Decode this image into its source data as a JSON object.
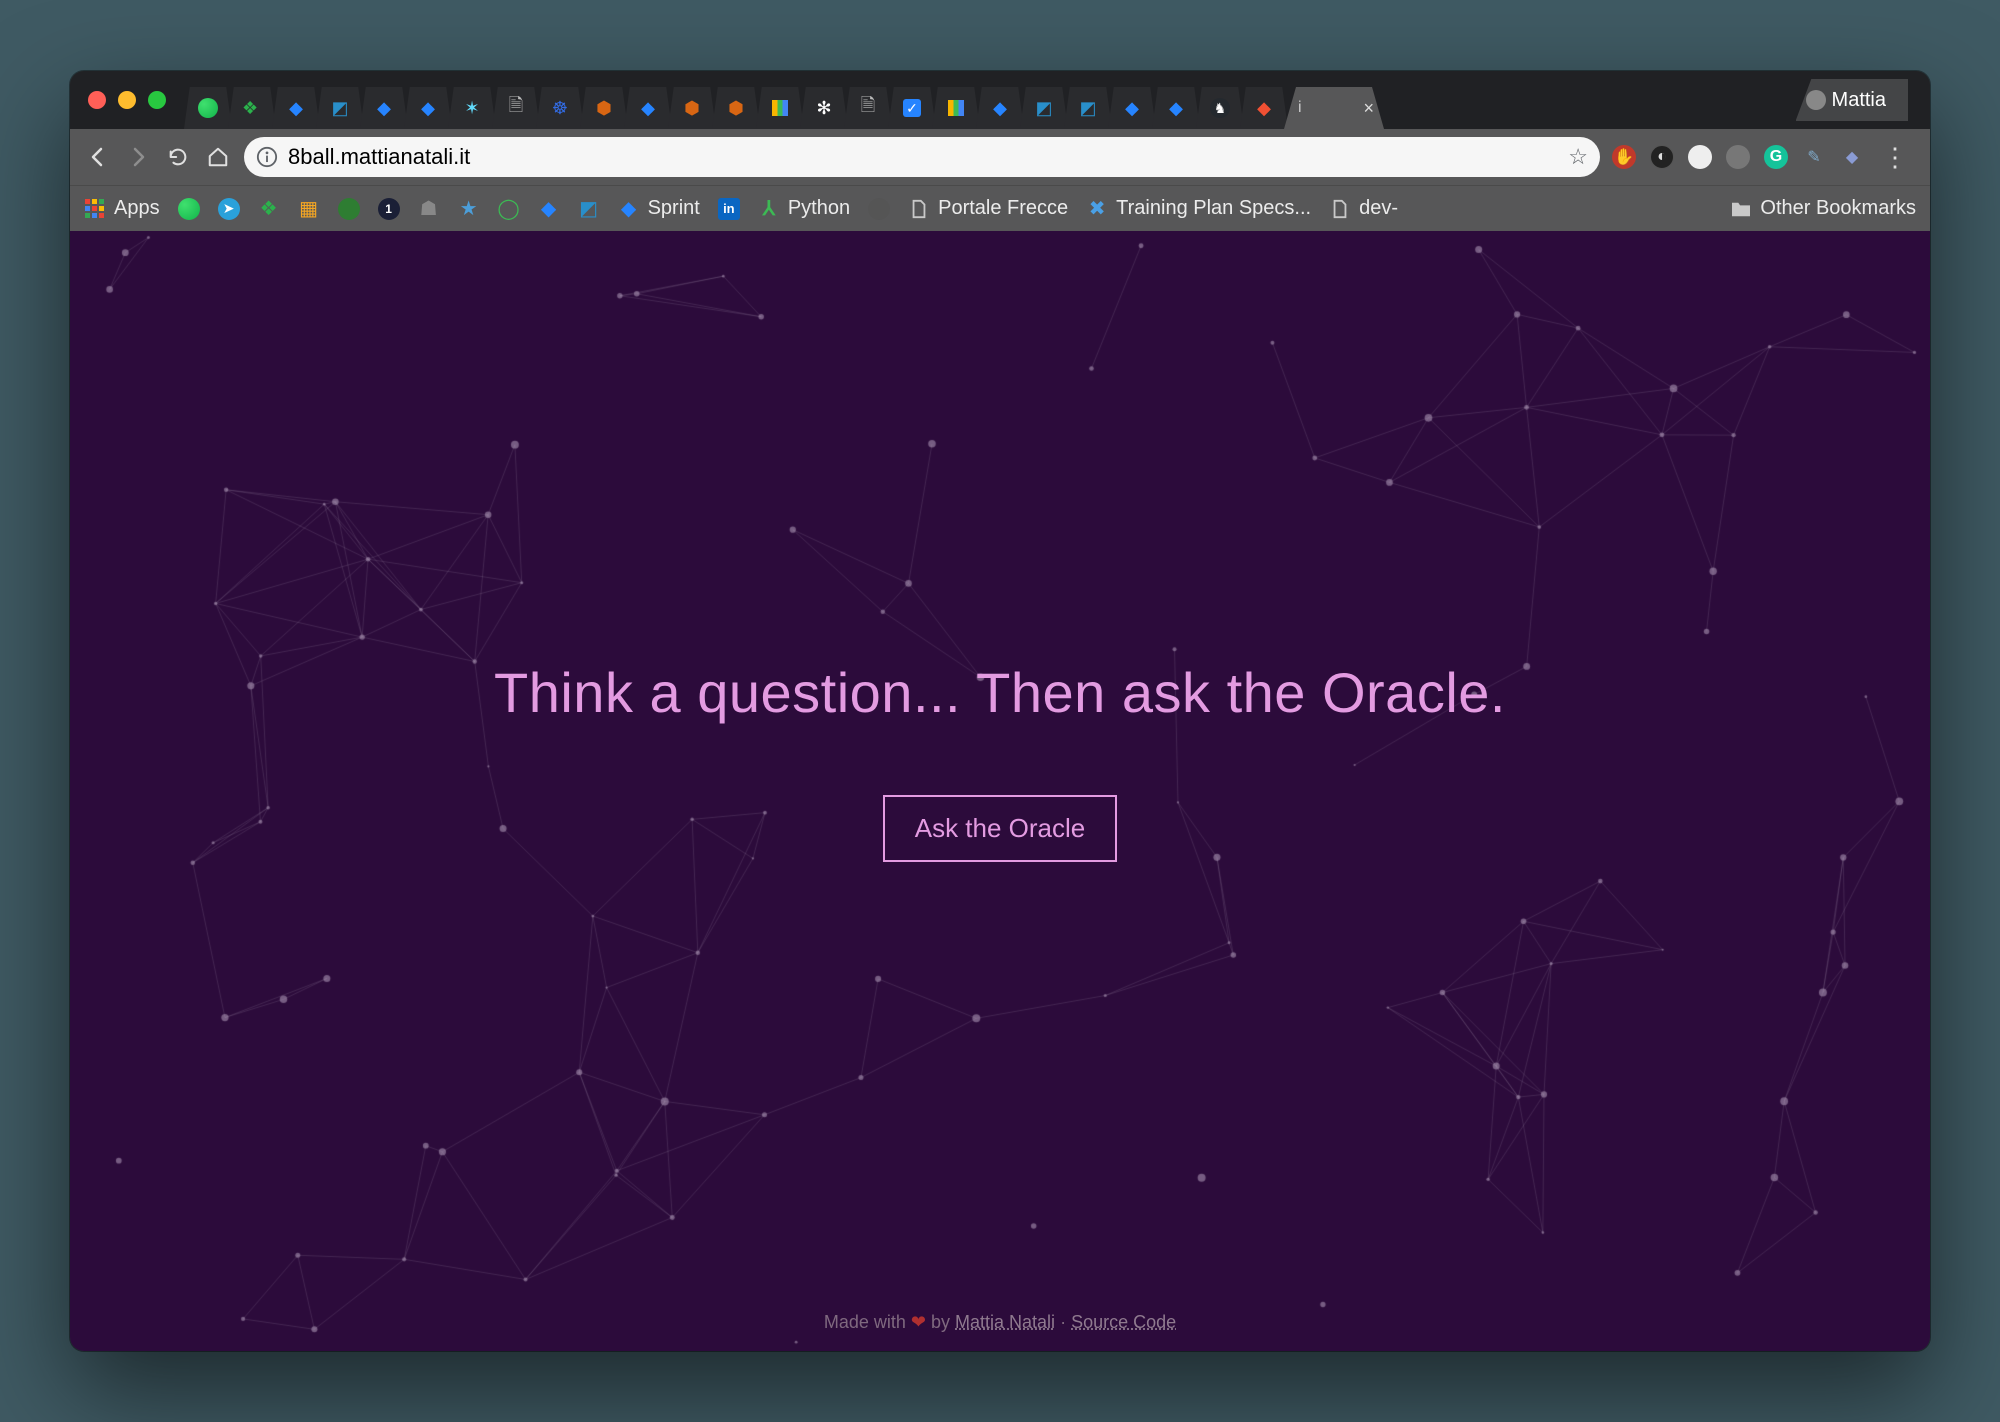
{
  "window": {
    "profile_name": "Mattia"
  },
  "toolbar": {
    "url": "8ball.mattianatali.it"
  },
  "bookmarks": {
    "apps_label": "Apps",
    "sprint_label": "Sprint",
    "python_label": "Python",
    "portale_label": "Portale Frecce",
    "training_label": "Training Plan Specs...",
    "dev_label": "dev-",
    "other_label": "Other Bookmarks"
  },
  "page": {
    "heading": "Think a question... Then ask the Oracle.",
    "button_label": "Ask the Oracle",
    "footer_prefix": "Made with ",
    "footer_by": "by ",
    "footer_author": "Mattia Natali",
    "footer_sep": " · ",
    "footer_source": "Source Code"
  }
}
